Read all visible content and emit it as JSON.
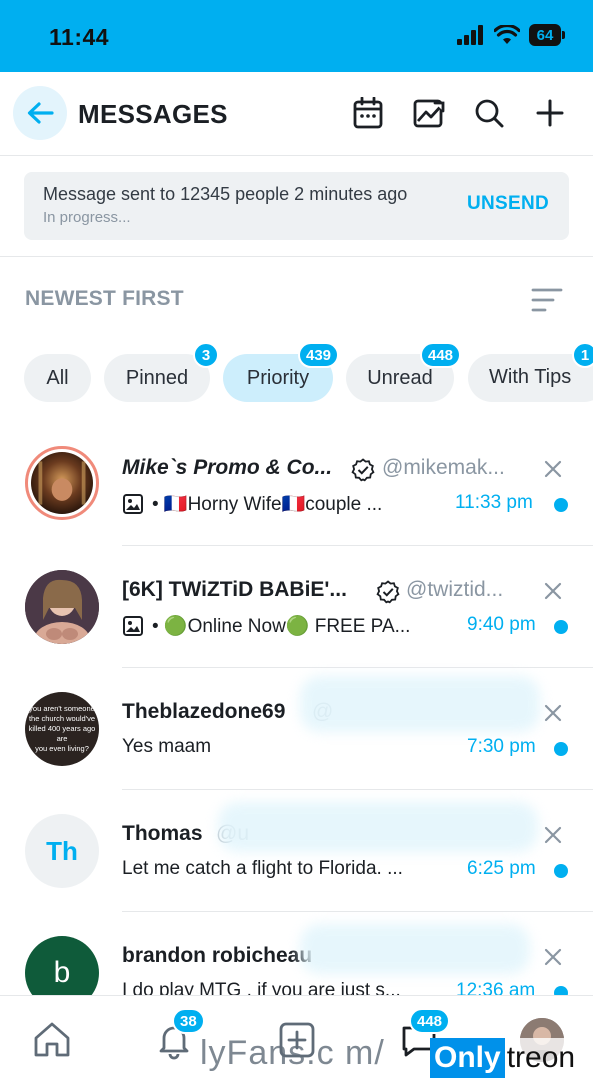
{
  "status_bar": {
    "time": "11:44",
    "battery": "64"
  },
  "header": {
    "title": "MESSAGES",
    "icons": [
      "back-arrow-icon",
      "calendar-icon",
      "image-chart-icon",
      "search-icon",
      "plus-icon"
    ]
  },
  "banner": {
    "text": "Message sent to 12345 people 2 minutes ago",
    "status": "In progress...",
    "action": "UNSEND"
  },
  "sort": {
    "label": "NEWEST FIRST"
  },
  "filters": [
    {
      "label": "All",
      "badge": ""
    },
    {
      "label": "Pinned",
      "badge": "3"
    },
    {
      "label": "Priority",
      "badge": "439"
    },
    {
      "label": "Unread",
      "badge": "448"
    },
    {
      "label": "With Tips",
      "badge": "1"
    }
  ],
  "messages": [
    {
      "name": "Mike`s Promo & Co...",
      "handle": "@mikemak...",
      "preview": "• 🇫🇷Horny Wife🇫🇷couple ...",
      "time": "11:33 pm",
      "verified": true,
      "has_media": true
    },
    {
      "name": "[6K] TWiZTiD BABiE'...",
      "handle": "@twiztid...",
      "preview": "• 🟢Online Now🟢 FREE PA...",
      "time": "9:40 pm",
      "verified": true,
      "has_media": true
    },
    {
      "name": "Theblazedone69",
      "handle": "@",
      "preview": "Yes maam",
      "time": "7:30 pm",
      "verified": false,
      "has_media": false,
      "avatar_text": [
        "you aren't someone",
        "the church would've",
        "killed 400 years ago are",
        "you even living?"
      ]
    },
    {
      "name": "Thomas",
      "handle": "@u",
      "preview": "Let me catch a flight to Florida. ...",
      "time": "6:25 pm",
      "verified": false,
      "has_media": false,
      "initials": "Th"
    },
    {
      "name": "brandon robicheau",
      "handle": "",
      "preview": "I do play MTG , if you are just s...",
      "time": "12:36 am",
      "verified": false,
      "has_media": false,
      "initials": "b"
    }
  ],
  "bottom_nav": {
    "items": [
      "home-icon",
      "notifications-icon",
      "add-post-icon",
      "messages-icon",
      "profile-avatar"
    ],
    "notifications_badge": "38",
    "messages_badge": "448"
  },
  "watermark": {
    "text": "lyFans.c m/",
    "brand_a": "Only",
    "brand_b": "treon"
  },
  "colors": {
    "accent": "#00aff0",
    "muted": "#8a96a2",
    "chip_bg": "#eef1f3",
    "chip_active_bg": "#cdeefc"
  }
}
